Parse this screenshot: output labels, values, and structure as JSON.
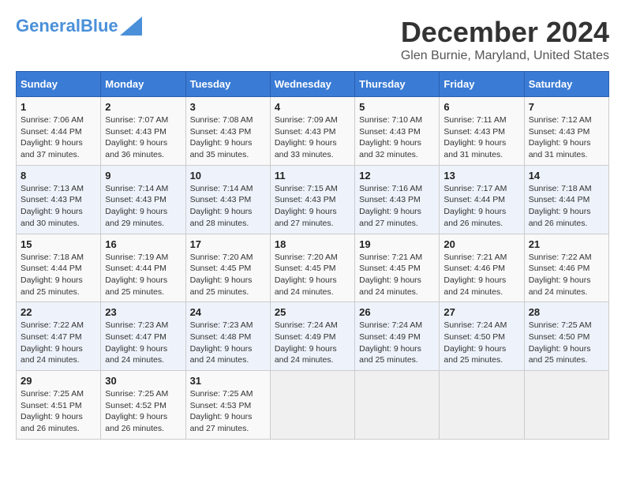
{
  "header": {
    "logo_general": "General",
    "logo_blue": "Blue",
    "month": "December 2024",
    "location": "Glen Burnie, Maryland, United States"
  },
  "weekdays": [
    "Sunday",
    "Monday",
    "Tuesday",
    "Wednesday",
    "Thursday",
    "Friday",
    "Saturday"
  ],
  "weeks": [
    [
      {
        "day": "1",
        "sunrise": "7:06 AM",
        "sunset": "4:44 PM",
        "daylight": "9 hours and 37 minutes."
      },
      {
        "day": "2",
        "sunrise": "7:07 AM",
        "sunset": "4:43 PM",
        "daylight": "9 hours and 36 minutes."
      },
      {
        "day": "3",
        "sunrise": "7:08 AM",
        "sunset": "4:43 PM",
        "daylight": "9 hours and 35 minutes."
      },
      {
        "day": "4",
        "sunrise": "7:09 AM",
        "sunset": "4:43 PM",
        "daylight": "9 hours and 33 minutes."
      },
      {
        "day": "5",
        "sunrise": "7:10 AM",
        "sunset": "4:43 PM",
        "daylight": "9 hours and 32 minutes."
      },
      {
        "day": "6",
        "sunrise": "7:11 AM",
        "sunset": "4:43 PM",
        "daylight": "9 hours and 31 minutes."
      },
      {
        "day": "7",
        "sunrise": "7:12 AM",
        "sunset": "4:43 PM",
        "daylight": "9 hours and 31 minutes."
      }
    ],
    [
      {
        "day": "8",
        "sunrise": "7:13 AM",
        "sunset": "4:43 PM",
        "daylight": "9 hours and 30 minutes."
      },
      {
        "day": "9",
        "sunrise": "7:14 AM",
        "sunset": "4:43 PM",
        "daylight": "9 hours and 29 minutes."
      },
      {
        "day": "10",
        "sunrise": "7:14 AM",
        "sunset": "4:43 PM",
        "daylight": "9 hours and 28 minutes."
      },
      {
        "day": "11",
        "sunrise": "7:15 AM",
        "sunset": "4:43 PM",
        "daylight": "9 hours and 27 minutes."
      },
      {
        "day": "12",
        "sunrise": "7:16 AM",
        "sunset": "4:43 PM",
        "daylight": "9 hours and 27 minutes."
      },
      {
        "day": "13",
        "sunrise": "7:17 AM",
        "sunset": "4:44 PM",
        "daylight": "9 hours and 26 minutes."
      },
      {
        "day": "14",
        "sunrise": "7:18 AM",
        "sunset": "4:44 PM",
        "daylight": "9 hours and 26 minutes."
      }
    ],
    [
      {
        "day": "15",
        "sunrise": "7:18 AM",
        "sunset": "4:44 PM",
        "daylight": "9 hours and 25 minutes."
      },
      {
        "day": "16",
        "sunrise": "7:19 AM",
        "sunset": "4:44 PM",
        "daylight": "9 hours and 25 minutes."
      },
      {
        "day": "17",
        "sunrise": "7:20 AM",
        "sunset": "4:45 PM",
        "daylight": "9 hours and 25 minutes."
      },
      {
        "day": "18",
        "sunrise": "7:20 AM",
        "sunset": "4:45 PM",
        "daylight": "9 hours and 24 minutes."
      },
      {
        "day": "19",
        "sunrise": "7:21 AM",
        "sunset": "4:45 PM",
        "daylight": "9 hours and 24 minutes."
      },
      {
        "day": "20",
        "sunrise": "7:21 AM",
        "sunset": "4:46 PM",
        "daylight": "9 hours and 24 minutes."
      },
      {
        "day": "21",
        "sunrise": "7:22 AM",
        "sunset": "4:46 PM",
        "daylight": "9 hours and 24 minutes."
      }
    ],
    [
      {
        "day": "22",
        "sunrise": "7:22 AM",
        "sunset": "4:47 PM",
        "daylight": "9 hours and 24 minutes."
      },
      {
        "day": "23",
        "sunrise": "7:23 AM",
        "sunset": "4:47 PM",
        "daylight": "9 hours and 24 minutes."
      },
      {
        "day": "24",
        "sunrise": "7:23 AM",
        "sunset": "4:48 PM",
        "daylight": "9 hours and 24 minutes."
      },
      {
        "day": "25",
        "sunrise": "7:24 AM",
        "sunset": "4:49 PM",
        "daylight": "9 hours and 24 minutes."
      },
      {
        "day": "26",
        "sunrise": "7:24 AM",
        "sunset": "4:49 PM",
        "daylight": "9 hours and 25 minutes."
      },
      {
        "day": "27",
        "sunrise": "7:24 AM",
        "sunset": "4:50 PM",
        "daylight": "9 hours and 25 minutes."
      },
      {
        "day": "28",
        "sunrise": "7:25 AM",
        "sunset": "4:50 PM",
        "daylight": "9 hours and 25 minutes."
      }
    ],
    [
      {
        "day": "29",
        "sunrise": "7:25 AM",
        "sunset": "4:51 PM",
        "daylight": "9 hours and 26 minutes."
      },
      {
        "day": "30",
        "sunrise": "7:25 AM",
        "sunset": "4:52 PM",
        "daylight": "9 hours and 26 minutes."
      },
      {
        "day": "31",
        "sunrise": "7:25 AM",
        "sunset": "4:53 PM",
        "daylight": "9 hours and 27 minutes."
      },
      null,
      null,
      null,
      null
    ]
  ]
}
